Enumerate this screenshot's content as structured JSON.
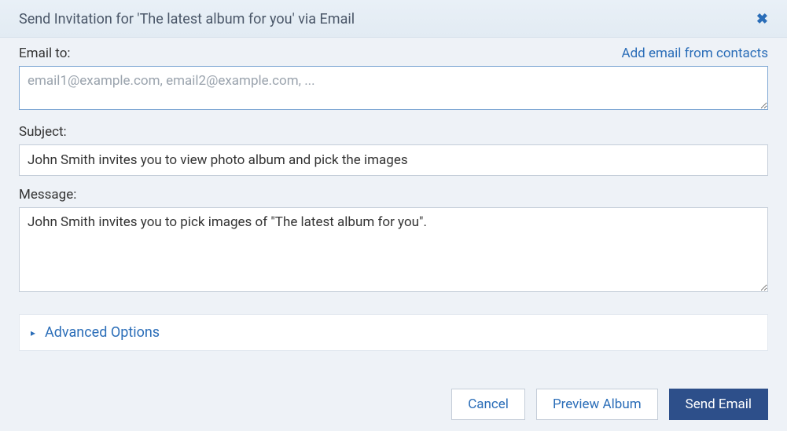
{
  "header": {
    "title": "Send Invitation for 'The latest album for you' via Email",
    "close_icon": "✖"
  },
  "email": {
    "label": "Email to:",
    "contacts_link": "Add email from contacts",
    "placeholder": "email1@example.com, email2@example.com, ...",
    "value": ""
  },
  "subject": {
    "label": "Subject:",
    "value": "John Smith invites you to view photo album and pick the images"
  },
  "message": {
    "label": "Message:",
    "value": "John Smith invites you to pick images of \"The latest album for you\"."
  },
  "advanced": {
    "label": "Advanced Options",
    "caret": "▸"
  },
  "footer": {
    "cancel": "Cancel",
    "preview": "Preview Album",
    "send": "Send Email"
  }
}
